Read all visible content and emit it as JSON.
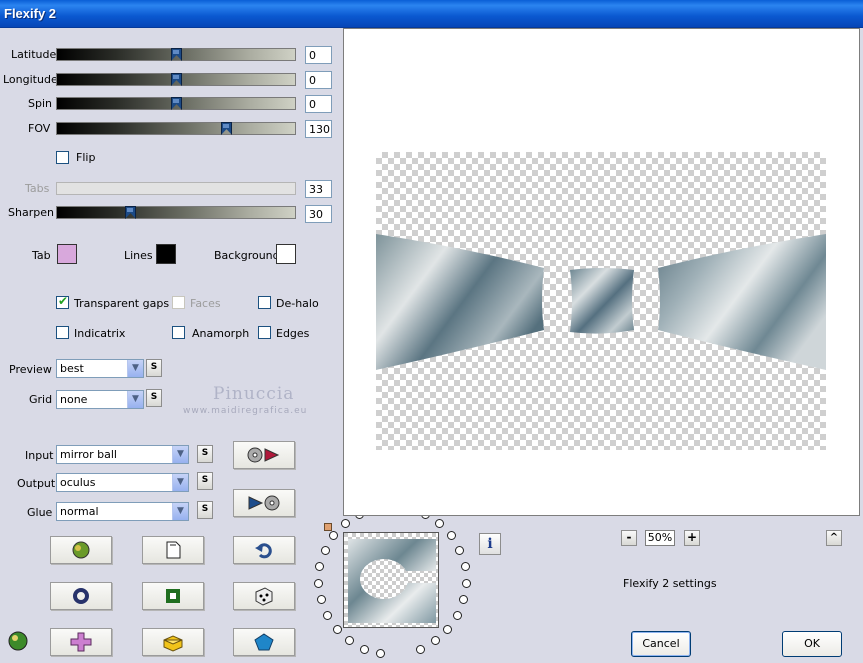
{
  "window": {
    "title": "Flexify 2"
  },
  "sliders": [
    {
      "label": "Latitude",
      "value": "0",
      "position": 0.5
    },
    {
      "label": "Longitude",
      "value": "0",
      "position": 0.5
    },
    {
      "label": "Spin",
      "value": "0",
      "position": 0.5
    },
    {
      "label": "FOV",
      "value": "130",
      "position": 0.72
    }
  ],
  "flip": {
    "label": "Flip",
    "checked": false
  },
  "tabs": {
    "label": "Tabs",
    "value": "33",
    "disabled": true
  },
  "sharpen": {
    "label": "Sharpen",
    "value": "30",
    "position": 0.3
  },
  "colors": {
    "tab": {
      "label": "Tab",
      "color": "#d8a8dc"
    },
    "lines": {
      "label": "Lines",
      "color": "#000000"
    },
    "background": {
      "label": "Background",
      "color": "#ffffff"
    }
  },
  "options": {
    "transparent_gaps": {
      "label": "Transparent gaps",
      "checked": true
    },
    "faces": {
      "label": "Faces",
      "checked": false,
      "disabled": true
    },
    "dehalo": {
      "label": "De-halo",
      "checked": false
    },
    "indicatrix": {
      "label": "Indicatrix",
      "checked": false
    },
    "anamorph": {
      "label": "Anamorph",
      "checked": false
    },
    "edges": {
      "label": "Edges",
      "checked": false
    }
  },
  "preview_select": {
    "label": "Preview",
    "value": "best"
  },
  "grid_select": {
    "label": "Grid",
    "value": "none"
  },
  "input_select": {
    "label": "Input",
    "value": "mirror ball"
  },
  "output_select": {
    "label": "Output",
    "value": "oculus"
  },
  "glue_select": {
    "label": "Glue",
    "value": "normal"
  },
  "s_label": "S",
  "watermark": {
    "name": "Pinuccia",
    "site": "www.maidiregrafica.eu"
  },
  "zoom": {
    "value": "50%",
    "minus": "-",
    "plus": "+"
  },
  "settings_label": "Flexify 2 settings",
  "collapse_label": "^",
  "info_label": "i",
  "buttons": {
    "cancel": "Cancel",
    "ok": "OK"
  }
}
